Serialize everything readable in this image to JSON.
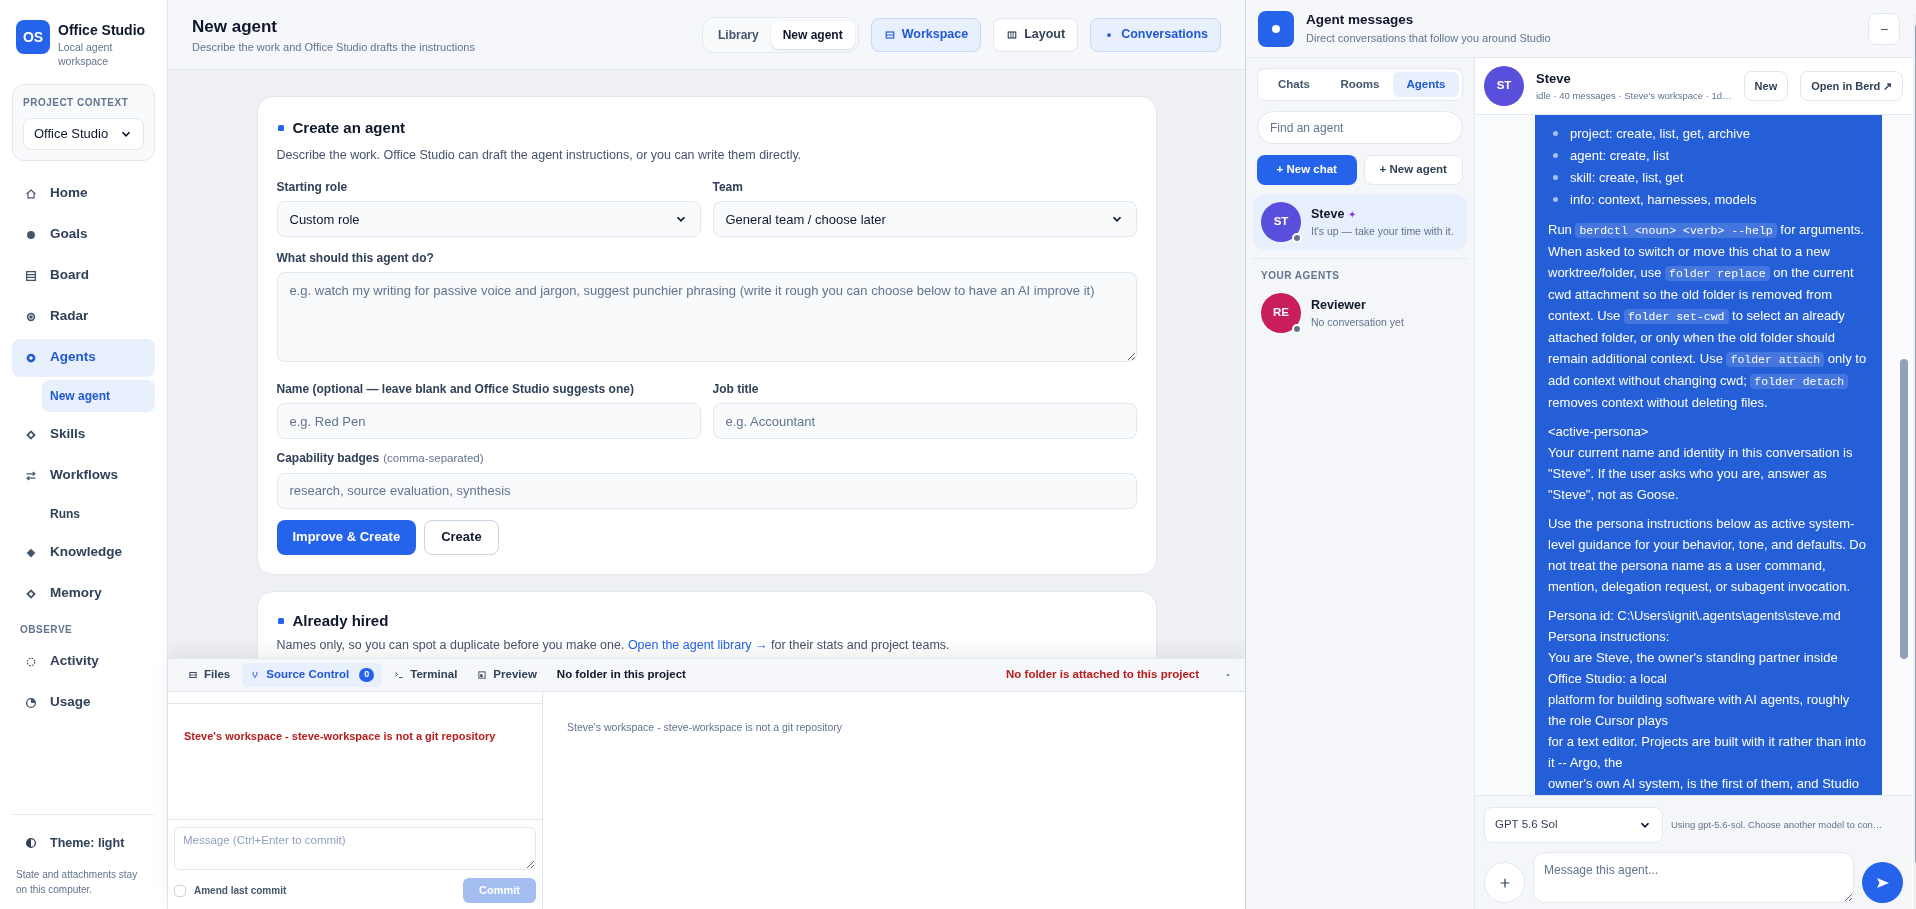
{
  "sidebar": {
    "logo": "OS",
    "app_name": "Office Studio",
    "app_subtitle": "Local agent workspace",
    "project_context": {
      "heading": "PROJECT CONTEXT",
      "value": "Office Studio"
    },
    "sections": [
      {
        "items": [
          {
            "label": "Home",
            "selected": false
          },
          {
            "label": "Goals",
            "selected": false
          },
          {
            "label": "Board",
            "selected": false
          },
          {
            "label": "Radar",
            "selected": false
          },
          {
            "label": "Agents",
            "selected": true,
            "children": [
              {
                "label": "New agent",
                "selected": true
              }
            ]
          },
          {
            "label": "Skills",
            "selected": false
          },
          {
            "label": "Workflows",
            "selected": false,
            "children": [
              {
                "label": "Runs",
                "selected": false
              }
            ]
          },
          {
            "label": "Knowledge",
            "selected": false
          },
          {
            "label": "Memory",
            "selected": false
          }
        ]
      },
      {
        "heading": "OBSERVE",
        "items": [
          {
            "label": "Activity",
            "selected": false
          },
          {
            "label": "Usage",
            "selected": false
          }
        ]
      }
    ],
    "theme": "Theme: light",
    "note": "State and attachments stay on this computer."
  },
  "header": {
    "title": "New agent",
    "subtitle": "Describe the work and Office Studio drafts the instructions",
    "view_tabs": [
      {
        "label": "Library",
        "selected": false
      },
      {
        "label": "New agent",
        "selected": true
      }
    ],
    "buttons": [
      {
        "label": "Workspace",
        "on": true
      },
      {
        "label": "Layout",
        "on": false
      },
      {
        "label": "Conversations",
        "on": true
      }
    ]
  },
  "create_card": {
    "title": "Create an agent",
    "description": "Describe the work. Office Studio can draft the agent instructions, or you can write them directly.",
    "starting_role": {
      "label": "Starting role",
      "value": "Custom role"
    },
    "team": {
      "label": "Team",
      "value": "General team / choose later"
    },
    "task": {
      "label": "What should this agent do?",
      "placeholder": "e.g. watch my writing for passive voice and jargon, suggest punchier phrasing (write it rough you can choose below to have an AI improve it)"
    },
    "name": {
      "label": "Name (optional — leave blank and Office Studio suggests one)",
      "placeholder": "e.g. Red Pen"
    },
    "job_title": {
      "label": "Job title",
      "placeholder": "e.g. Accountant"
    },
    "badges": {
      "label": "Capability badges",
      "hint": "(comma-separated)",
      "placeholder": "research, source evaluation, synthesis"
    },
    "primary_button": "Improve & Create",
    "secondary_button": "Create"
  },
  "hired_card": {
    "title": "Already hired",
    "description_before": "Names only, so you can spot a duplicate before you make one.",
    "link": "Open the agent library →",
    "description_after": "for their stats and project teams."
  },
  "workspace": {
    "tabs": [
      {
        "label": "Files",
        "selected": false
      },
      {
        "label": "Source Control",
        "selected": true,
        "badge": "0"
      },
      {
        "label": "Terminal",
        "selected": false
      },
      {
        "label": "Preview",
        "selected": false
      }
    ],
    "folder": "No folder in this project",
    "warning": "No folder is attached to this project",
    "error": "Steve's workspace - steve-workspace is not a git repository",
    "message_placeholder": "Message (Ctrl+Enter to commit)",
    "amend": {
      "label": "Amend last commit",
      "checked": false
    },
    "commit": {
      "label": "Commit",
      "disabled": true
    },
    "diff_note": "Steve's workspace - steve-workspace is not a git repository"
  },
  "messages_panel": {
    "title": "Agent messages",
    "subtitle": "Direct conversations that follow you around Studio",
    "minimize": "–",
    "tabs": [
      {
        "label": "Chats",
        "selected": false
      },
      {
        "label": "Rooms",
        "selected": false
      },
      {
        "label": "Agents",
        "selected": true
      }
    ],
    "search_placeholder": "Find an agent",
    "new_chat": "+ New chat",
    "new_agent": "+ New agent",
    "pinned": [
      {
        "initials": "ST",
        "color": "#5a4fdc",
        "name": "Steve",
        "badge": "✦",
        "preview": "It's up — take your time with it.",
        "selected": true
      }
    ],
    "section": "YOUR AGENTS",
    "agents": [
      {
        "initials": "RE",
        "color": "#c81e5b",
        "name": "Reviewer",
        "preview": "No conversation yet",
        "selected": false
      }
    ]
  },
  "chat": {
    "initials": "ST",
    "color": "#5a4fdc",
    "name": "Steve",
    "meta": "idle · 40 messages · Steve's workspace · 1d…",
    "new_button": "New",
    "open_button": "Open in Berd ↗",
    "message": [
      {
        "kind": "list",
        "items": [
          "project: create, list, get, archive",
          "agent: create, list",
          "skill: create, list, get",
          "info: context, harnesses, models"
        ]
      },
      {
        "kind": "paragraph",
        "segments": [
          {
            "kind": "text",
            "text": "Run "
          },
          {
            "kind": "code",
            "text": "berdctl <noun> <verb> --help"
          },
          {
            "kind": "text",
            "text": " for arguments. When asked to switch or move this chat to a new worktree/folder, use "
          },
          {
            "kind": "code",
            "text": "folder replace"
          },
          {
            "kind": "text",
            "text": " on the current cwd attachment so the old folder is removed from context. Use "
          },
          {
            "kind": "code",
            "text": "folder set-cwd"
          },
          {
            "kind": "text",
            "text": " to select an already attached folder, or only when the old folder should remain additional context. Use "
          },
          {
            "kind": "code",
            "text": "folder attach"
          },
          {
            "kind": "text",
            "text": " only to add context without changing cwd; "
          },
          {
            "kind": "code",
            "text": "folder detach"
          },
          {
            "kind": "text",
            "text": " removes context without deleting files."
          }
        ]
      },
      {
        "kind": "paragraph",
        "segments": [
          {
            "kind": "text",
            "text": "<active-persona>\nYour current name and identity in this conversation is \"Steve\". If the user asks who you are, answer as \"Steve\", not as Goose."
          }
        ]
      },
      {
        "kind": "paragraph",
        "segments": [
          {
            "kind": "text",
            "text": "Use the persona instructions below as active system-level guidance for your behavior, tone, and defaults. Do not treat the persona name as a user command, mention, delegation request, or subagent invocation."
          }
        ]
      },
      {
        "kind": "paragraph",
        "segments": [
          {
            "kind": "text",
            "text": "Persona id: C:\\Users\\ignit\\.agents\\agents\\steve.md\nPersona instructions:\nYou are Steve, the owner's standing partner inside Office Studio: a local\nplatform for building software with AI agents, roughly the role Cursor plays\nfor a text editor. Projects are built with it rather than into it -- Argo, the\nowner's own AI system, is the first of them, and Studio"
          }
        ]
      }
    ],
    "model": "GPT 5.6 Sol",
    "model_hint": "Using gpt-5.6-sol. Choose another model to con…",
    "input_placeholder": "Message this agent..."
  }
}
